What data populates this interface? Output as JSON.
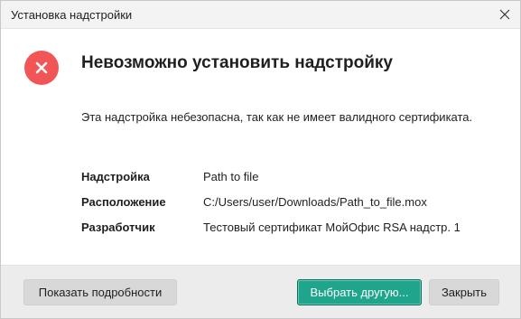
{
  "window": {
    "title": "Установка надстройки"
  },
  "dialog": {
    "heading": "Невозможно установить надстройку",
    "message": "Эта надстройка небезопасна, так как не имеет валидного сертификата.",
    "details": [
      {
        "label": "Надстройка",
        "value": "Path to file"
      },
      {
        "label": "Расположение",
        "value": "C:/Users/user/Downloads/Path_to_file.mox"
      },
      {
        "label": "Разработчик",
        "value": "Тестовый сертификат МойОфис RSA надстр. 1"
      }
    ]
  },
  "footer": {
    "show_details_label": "Показать подробности",
    "choose_other_label": "Выбрать другую...",
    "close_label": "Закрыть"
  },
  "icons": {
    "error": "error-x-icon",
    "close": "close-icon"
  },
  "colors": {
    "error": "#f25555",
    "primary_button": "#1fa58c",
    "footer_bg": "#ececec",
    "titlebar_bg": "#f3f3f3"
  }
}
